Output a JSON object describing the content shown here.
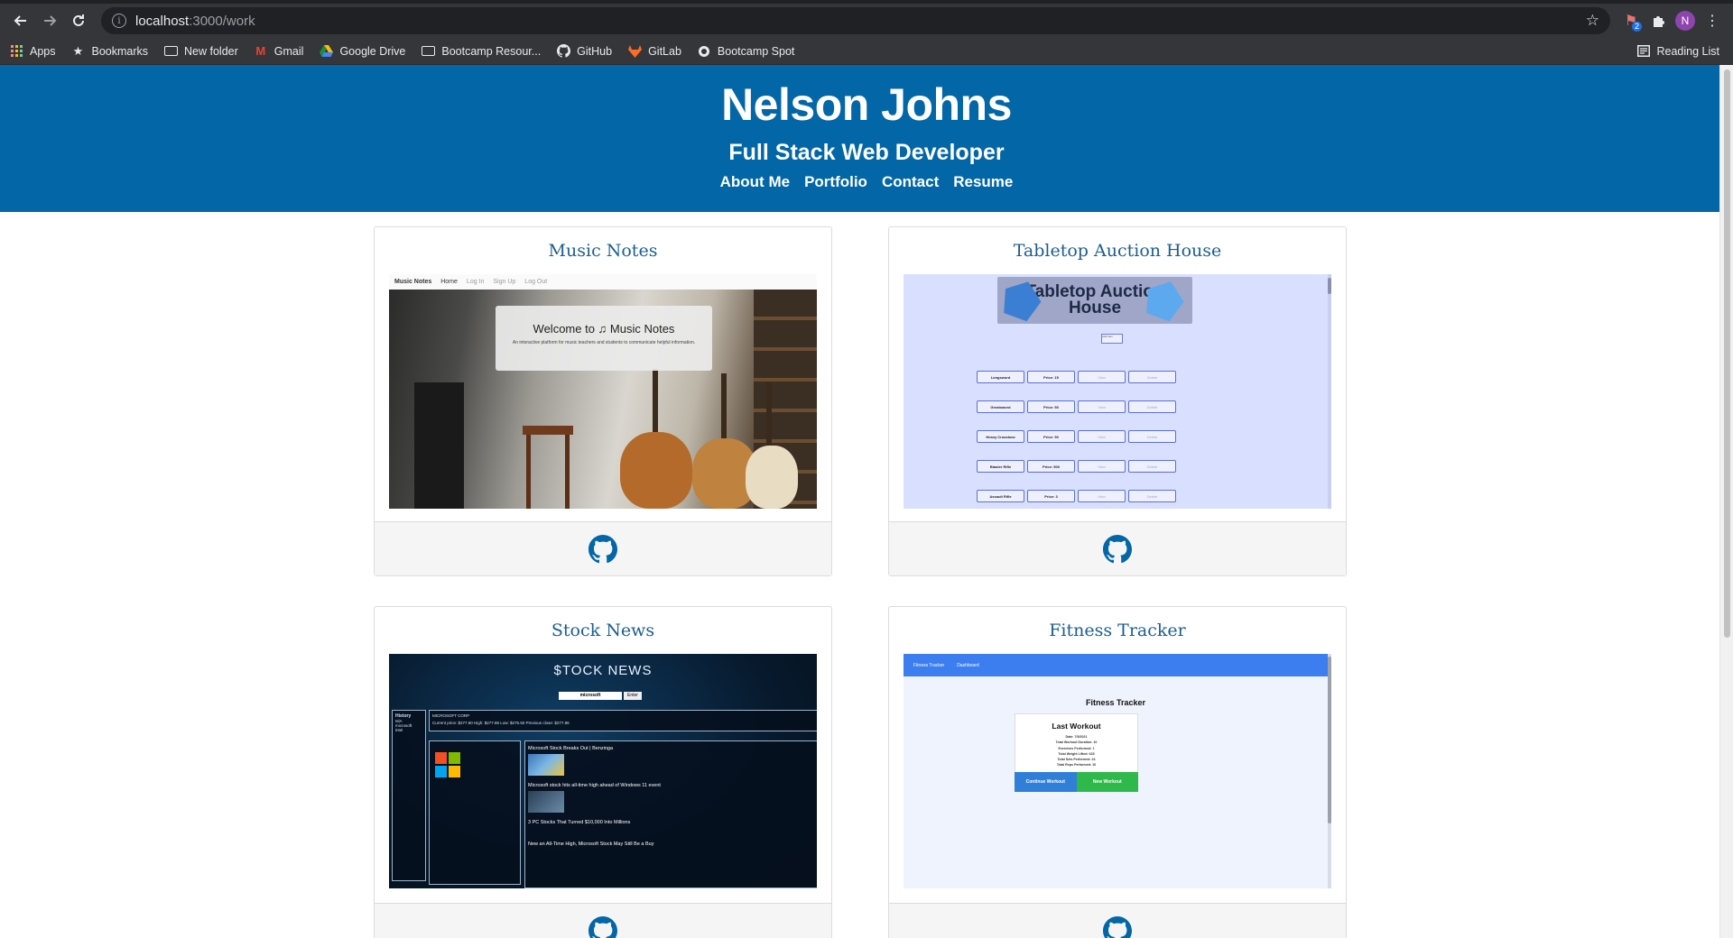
{
  "browser": {
    "url_host": "localhost",
    "url_path": ":3000/work",
    "extension_badge": "2",
    "profile_initial": "N",
    "bookmarks": [
      {
        "label": "Apps",
        "icon": "apps-grid-icon"
      },
      {
        "label": "Bookmarks",
        "icon": "star-icon"
      },
      {
        "label": "New folder",
        "icon": "folder-icon"
      },
      {
        "label": "Gmail",
        "icon": "gmail-icon"
      },
      {
        "label": "Google Drive",
        "icon": "google-drive-icon"
      },
      {
        "label": "Bootcamp Resour...",
        "icon": "folder-icon"
      },
      {
        "label": "GitHub",
        "icon": "github-icon"
      },
      {
        "label": "GitLab",
        "icon": "gitlab-icon"
      },
      {
        "label": "Bootcamp Spot",
        "icon": "globe-icon"
      }
    ],
    "reading_list": "Reading List"
  },
  "header": {
    "name": "Nelson Johns",
    "role": "Full Stack Web Developer",
    "nav": [
      "About Me",
      "Portfolio",
      "Contact",
      "Resume"
    ],
    "bg_color": "#0366a6"
  },
  "projects": [
    {
      "title": "Music Notes",
      "screenshot": {
        "nav": [
          "Music Notes",
          "Home",
          "Log In",
          "Sign Up",
          "Log Out"
        ],
        "welcome": "Welcome to ♫ Music Notes",
        "subtitle": "An interactive platform for music teachers and students to communicate helpful information."
      },
      "link_icon": "github-icon"
    },
    {
      "title": "Tabletop Auction House",
      "screenshot": {
        "banner": "Tabletop Auction House",
        "add_button": "Add Item",
        "rows": [
          {
            "item": "Longsword",
            "price": "Price: 15"
          },
          {
            "item": "Greatsword",
            "price": "Price: 50"
          },
          {
            "item": "Heavy Crossbow",
            "price": "Price: 50"
          },
          {
            "item": "Blaster Rifle",
            "price": "Price: 500"
          },
          {
            "item": "Assault Rifle",
            "price": "Price: 3"
          }
        ],
        "view_label": "View",
        "delete_label": "Delete"
      },
      "link_icon": "github-icon"
    },
    {
      "title": "Stock News",
      "screenshot": {
        "title": "$TOCK NEWS",
        "search_value": "microsoft",
        "search_button": "Enter",
        "history_label": "History",
        "history_items": [
          "tslA",
          "microsoft",
          "intel"
        ],
        "company": "MICROSOFT CORP",
        "price_line": "Current price: $277.60 High: $277.86 Low: $275.50 Previous close: $277.86",
        "articles": [
          "Microsoft Stock Breaks Out | Benzinga",
          "Microsoft stock hits all-time high ahead of Windows 11 event",
          "3 PC Stocks That Turned $10,000 Into Millions",
          "New an All-Time High, Microsoft Stock May Still Be a Buy"
        ]
      },
      "link_icon": "github-icon"
    },
    {
      "title": "Fitness Tracker",
      "screenshot": {
        "nav": [
          "Fitness Tracker",
          "Dashboard"
        ],
        "heading": "Fitness Tracker",
        "card_title": "Last Workout",
        "lines": [
          "Date: 7/5/2021",
          "Total Workout Duration: 10",
          "Exercises Performed: 1",
          "Total Weight Lifted: 625",
          "Total Sets Performed: 24",
          "Total Reps Performed: 10"
        ],
        "continue_button": "Continue Workout",
        "new_button": "New Workout"
      },
      "link_icon": "github-icon"
    }
  ]
}
